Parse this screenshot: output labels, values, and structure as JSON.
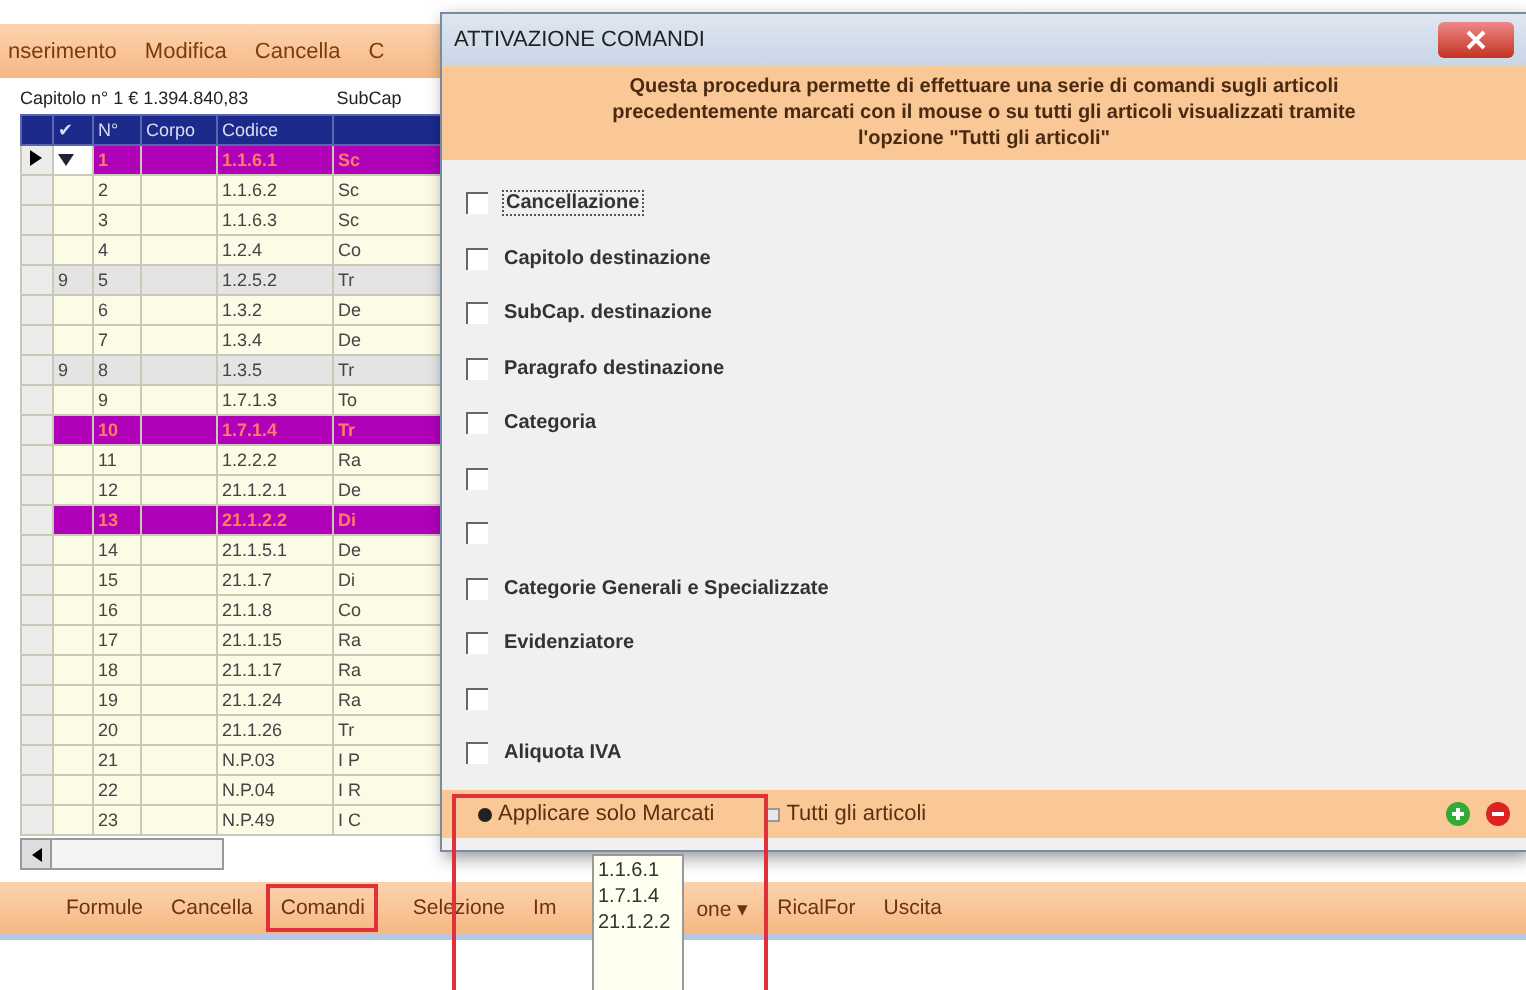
{
  "app": {
    "menu": [
      "nserimento",
      "Modifica",
      "Cancella",
      "C"
    ],
    "chapter": {
      "label": "Capitolo n° 1 € 1.394.840,83",
      "subchapter": "SubCap"
    },
    "table": {
      "columns": [
        "✔",
        "N°",
        "Corpo",
        "Codice"
      ],
      "rows": [
        {
          "n": "1",
          "group": "",
          "code": "1.1.6.1",
          "column_5": "Sc",
          "marked": true,
          "current": true
        },
        {
          "n": "2",
          "group": "",
          "code": "1.1.6.2",
          "column_5": "Sc",
          "marked": false,
          "current": false
        },
        {
          "n": "3",
          "group": "",
          "code": "1.1.6.3",
          "column_5": "Sc",
          "marked": false,
          "current": false
        },
        {
          "n": "4",
          "group": "",
          "code": "1.2.4",
          "column_5": "Co",
          "marked": false,
          "current": false
        },
        {
          "n": "5",
          "group": "9",
          "code": "1.2.5.2",
          "column_5": "Tr",
          "marked": false,
          "current": false
        },
        {
          "n": "6",
          "group": "",
          "code": "1.3.2",
          "column_5": "De",
          "marked": false,
          "current": false
        },
        {
          "n": "7",
          "group": "",
          "code": "1.3.4",
          "column_5": "De",
          "marked": false,
          "current": false
        },
        {
          "n": "8",
          "group": "9",
          "code": "1.3.5",
          "column_5": "Tr",
          "marked": false,
          "current": false
        },
        {
          "n": "9",
          "group": "",
          "code": "1.7.1.3",
          "column_5": "To",
          "marked": false,
          "current": false
        },
        {
          "n": "10",
          "group": "",
          "code": "1.7.1.4",
          "column_5": "Tr",
          "marked": true,
          "current": false
        },
        {
          "n": "11",
          "group": "",
          "code": "1.2.2.2",
          "column_5": "Ra",
          "marked": false,
          "current": false
        },
        {
          "n": "12",
          "group": "",
          "code": "21.1.2.1",
          "column_5": "De",
          "marked": false,
          "current": false
        },
        {
          "n": "13",
          "group": "",
          "code": "21.1.2.2",
          "column_5": "Di",
          "marked": true,
          "current": false
        },
        {
          "n": "14",
          "group": "",
          "code": "21.1.5.1",
          "column_5": "De",
          "marked": false,
          "current": false
        },
        {
          "n": "15",
          "group": "",
          "code": "21.1.7",
          "column_5": "Di",
          "marked": false,
          "current": false
        },
        {
          "n": "16",
          "group": "",
          "code": "21.1.8",
          "column_5": "Co",
          "marked": false,
          "current": false
        },
        {
          "n": "17",
          "group": "",
          "code": "21.1.15",
          "column_5": "Ra",
          "marked": false,
          "current": false
        },
        {
          "n": "18",
          "group": "",
          "code": "21.1.17",
          "column_5": "Ra",
          "marked": false,
          "current": false
        },
        {
          "n": "19",
          "group": "",
          "code": "21.1.24",
          "column_5": "Ra",
          "marked": false,
          "current": false
        },
        {
          "n": "20",
          "group": "",
          "code": "21.1.26",
          "column_5": "Tr",
          "marked": false,
          "current": false
        },
        {
          "n": "21",
          "group": "",
          "code": "N.P.03",
          "column_5": "I P",
          "marked": false,
          "current": false
        },
        {
          "n": "22",
          "group": "",
          "code": "N.P.04",
          "column_5": "I R",
          "marked": false,
          "current": false
        },
        {
          "n": "23",
          "group": "",
          "code": "N.P.49",
          "column_5": "I C",
          "marked": false,
          "current": false
        }
      ]
    },
    "toolbar": [
      {
        "kind": "button",
        "label": "Formule",
        "highlighted": false
      },
      {
        "kind": "button",
        "label": "Cancella",
        "highlighted": false
      },
      {
        "kind": "button",
        "label": "Comandi",
        "highlighted": true
      },
      {
        "kind": "button",
        "label": "Selezione",
        "highlighted": false
      },
      {
        "kind": "dropdown",
        "label_start": "Im",
        "label_end": "one",
        "caret": "▾",
        "highlighted": false
      },
      {
        "kind": "button",
        "label": "RicalFor",
        "highlighted": false
      },
      {
        "kind": "button",
        "label": "Uscita",
        "highlighted": false
      }
    ]
  },
  "dialog": {
    "title": "ATTIVAZIONE COMANDI",
    "info": "Questa procedura permette di effettuare una serie di comandi sugli articoli precedentemente marcati con il mouse o su tutti gli articoli visualizzati tramite l'opzione \"Tutti gli articoli\"",
    "options": [
      {
        "label": "Cancellazione",
        "checked": false,
        "focused": true
      },
      {
        "label": "Capitolo destinazione",
        "checked": false,
        "focused": false
      },
      {
        "label": "SubCap. destinazione",
        "checked": false,
        "focused": false
      },
      {
        "label": "Paragrafo destinazione",
        "checked": false,
        "focused": false
      },
      {
        "label": "Categoria",
        "checked": false,
        "focused": false
      },
      {
        "checked": false
      },
      {
        "checked": false
      },
      {
        "label": "Categorie Generali e Specializzate",
        "checked": false,
        "focused": false
      },
      {
        "label": "Evidenziatore",
        "checked": false,
        "focused": false
      },
      {
        "checked": false
      },
      {
        "label": "Aliquota IVA",
        "checked": false,
        "focused": false
      }
    ],
    "scope": [
      {
        "label": "Applicare solo Marcati",
        "selected": true,
        "highlighted": true
      },
      {
        "label": "Tutti gli articoli",
        "selected": false,
        "highlighted": false
      }
    ]
  },
  "marked_codes": [
    "1.1.6.1",
    "1.7.1.4",
    "21.1.2.2"
  ]
}
